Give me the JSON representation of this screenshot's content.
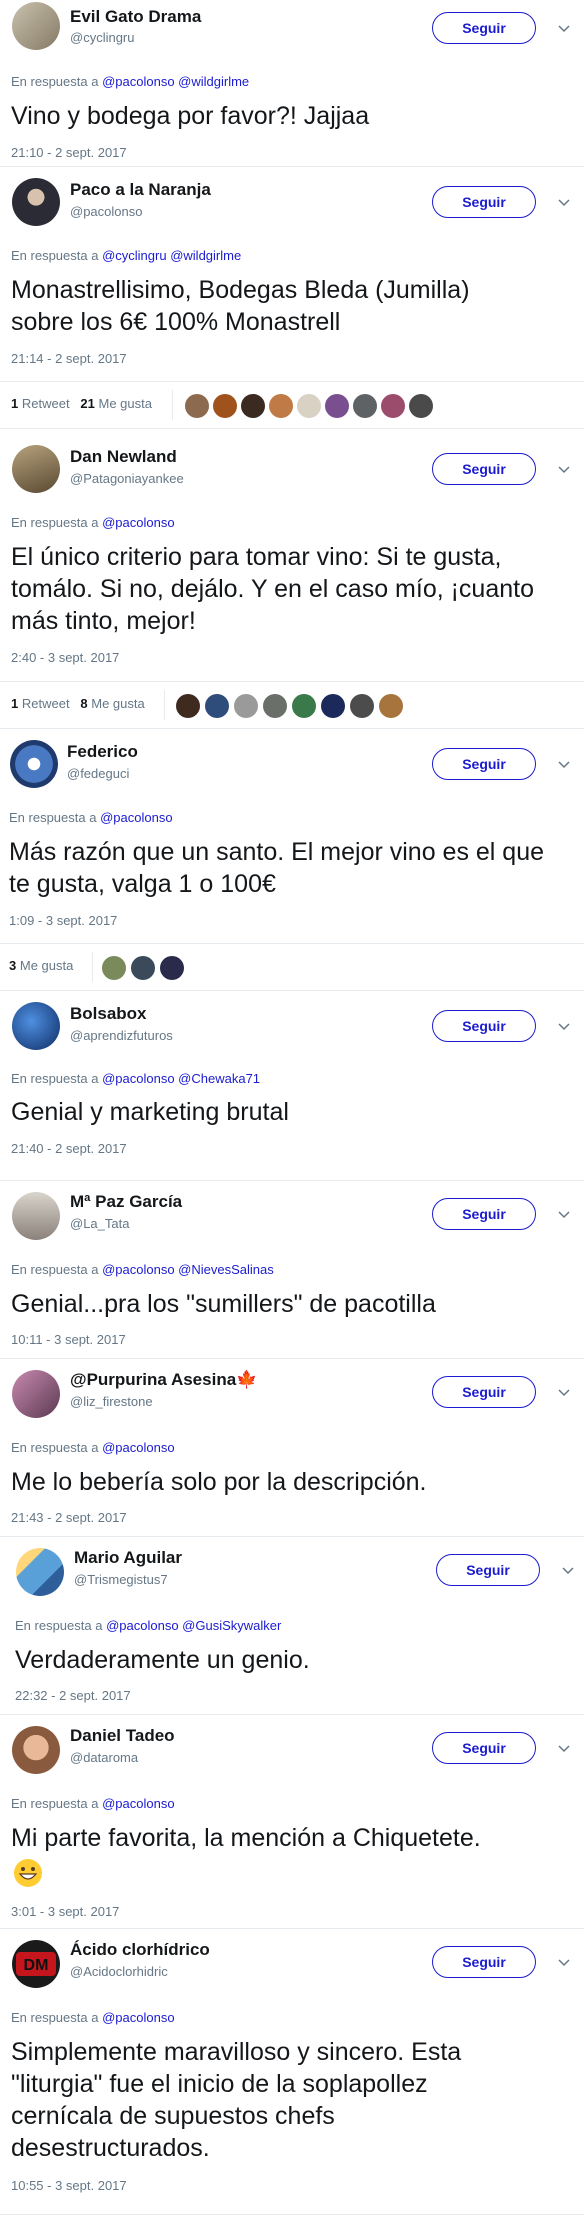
{
  "follow_label": "Seguir",
  "reply_prefix": "En respuesta a",
  "tweets": [
    {
      "name": "Evil Gato Drama",
      "handle": "@cyclingru",
      "mentions": [
        "@pacolonso",
        "@wildgirlme"
      ],
      "text": "Vino y bodega por favor?! Jajjaa",
      "time": "21:10 - 2 sept. 2017",
      "avatar_color": "#9a8f78"
    },
    {
      "name": "Paco a la Naranja",
      "handle": "@pacolonso",
      "mentions": [
        "@cyclingru",
        "@wildgirlme"
      ],
      "text": "Monastrellisimo, Bodegas Bleda (Jumilla) sobre los 6€ 100% Monastrell",
      "time": "21:14 - 2 sept. 2017",
      "avatar_color": "#2b2b35",
      "retweets_count": "1",
      "retweets_label": "Retweet",
      "likes_count": "21",
      "likes_label": "Me gusta"
    },
    {
      "name": "Dan Newland",
      "handle": "@Patagoniayankee",
      "mentions": [
        "@pacolonso"
      ],
      "text": "El único criterio para tomar vino: Si te gusta, tomálo. Si no, dejálo. Y en el caso mío, ¡cuanto más tinto, mejor!",
      "time": "2:40 - 3 sept. 2017",
      "avatar_color": "#7a6a4e",
      "retweets_count": "1",
      "retweets_label": "Retweet",
      "likes_count": "8",
      "likes_label": "Me gusta"
    },
    {
      "name": "Federico",
      "handle": "@fedeguci",
      "mentions": [
        "@pacolonso"
      ],
      "text": "Más razón que un santo. El mejor vino es el que te gusta, valga 1 o 100€",
      "time": "1:09 - 3 sept. 2017",
      "avatar_color": "#4a79c4",
      "likes_count": "3",
      "likes_label": "Me gusta"
    },
    {
      "name": "Bolsabox",
      "handle": "@aprendizfuturos",
      "mentions": [
        "@pacolonso",
        "@Chewaka71"
      ],
      "text": "Genial y marketing brutal",
      "time": "21:40 - 2 sept. 2017",
      "avatar_color": "#1d4f9a"
    },
    {
      "name": "Mª Paz García",
      "handle": "@La_Tata",
      "mentions": [
        "@pacolonso",
        "@NievesSalinas"
      ],
      "text": "Genial...pra los \"sumillers\" de pacotilla",
      "time": "10:11 - 3 sept. 2017",
      "avatar_color": "#b9b4ae"
    },
    {
      "name": "@Purpurina Asesina",
      "name_flag": "🍁",
      "handle": "@liz_firestone",
      "mentions": [
        "@pacolonso"
      ],
      "text": "Me lo bebería solo por la descripción.",
      "time": "21:43 - 2 sept. 2017",
      "avatar_color": "#8b5b7a"
    },
    {
      "name": "Mario Aguilar",
      "handle": "@Trismegistus7",
      "mentions": [
        "@pacolonso",
        "@GusiSkywalker"
      ],
      "text": "Verdaderamente un genio.",
      "time": "22:32 - 2 sept. 2017",
      "avatar_color": "#5aa0d8"
    },
    {
      "name": "Daniel Tadeo",
      "handle": "@dataroma",
      "mentions": [
        "@pacolonso"
      ],
      "text": "Mi parte favorita, la mención a Chiquetete.",
      "time": "3:01 - 3 sept. 2017",
      "avatar_color": "#c98e6e"
    },
    {
      "name": "Ácido clorhídrico",
      "handle": "@Acidoclorhidric",
      "mentions": [
        "@pacolonso"
      ],
      "text": "Simplemente maravilloso y sincero. Esta \"liturgia\" fue el inicio de la soplapollez cernícala de supuestos chefs desestructurados.",
      "time": "10:55 - 3 sept. 2017",
      "avatar_color": "#1a1a1a"
    }
  ],
  "colors": {
    "link": "#1b1bd0",
    "muted": "#657786",
    "text": "#14171a",
    "divider": "#e6ecf0"
  }
}
